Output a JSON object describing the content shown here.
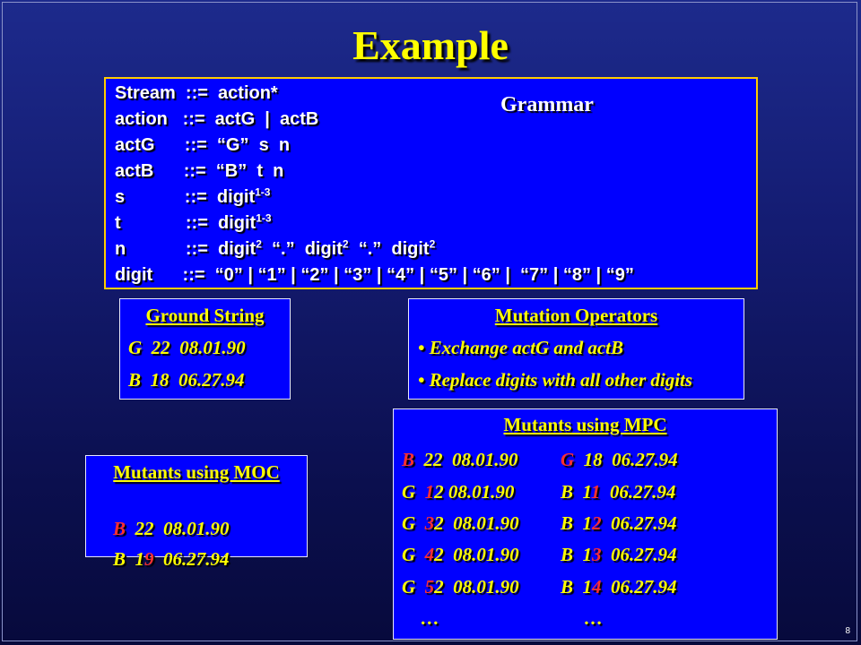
{
  "title": "Example",
  "grammar": {
    "label": "Grammar",
    "lines": [
      {
        "text": "Stream  ::=  action*"
      },
      {
        "text": "action   ::=  actG  |  actB"
      },
      {
        "text": "actG      ::=  “G”  s  n"
      },
      {
        "text": "actB      ::=  “B”  t  n"
      },
      {
        "text": "s            ::=  digit",
        "sup": "1-3"
      },
      {
        "text": "t             ::=  digit",
        "sup": "1-3"
      },
      {
        "text": "n            ::=  digit",
        "sup": "2",
        "t2": "  “.”  digit",
        "sup2": "2",
        "t3": "  “.”  digit",
        "sup3": "2"
      },
      {
        "text": "digit      ::=  “0” | “1” | “2” | “3” | “4” | “5” | “6” |  “7” | “8” | “9”"
      }
    ]
  },
  "ground": {
    "title": "Ground String",
    "lines": [
      "G  22  08.01.90",
      "B  18  06.27.94"
    ]
  },
  "mutation_operators": {
    "title": "Mutation Operators",
    "items": [
      "• Exchange actG and actB",
      "• Replace digits with all other digits"
    ]
  },
  "moc": {
    "title": "Mutants using MOC",
    "rows": [
      [
        {
          "t": "B",
          "r": true
        },
        {
          "t": "  22  08.01.90"
        }
      ],
      [
        {
          "t": "B  1"
        },
        {
          "t": "9",
          "r": true
        },
        {
          "t": "  06.27.94"
        }
      ]
    ]
  },
  "mpc": {
    "title": "Mutants using MPC",
    "left": [
      [
        {
          "t": "B",
          "r": true
        },
        {
          "t": "  22  08.01.90"
        }
      ],
      [
        {
          "t": "G  "
        },
        {
          "t": "1",
          "r": true
        },
        {
          "t": "2 08.01.90"
        }
      ],
      [
        {
          "t": "G  "
        },
        {
          "t": "3",
          "r": true
        },
        {
          "t": "2  08.01.90"
        }
      ],
      [
        {
          "t": "G  "
        },
        {
          "t": "4",
          "r": true
        },
        {
          "t": "2  08.01.90"
        }
      ],
      [
        {
          "t": "G  "
        },
        {
          "t": "5",
          "r": true
        },
        {
          "t": "2  08.01.90"
        }
      ],
      [
        {
          "t": "    …"
        }
      ]
    ],
    "right": [
      [
        {
          "t": "G",
          "r": true
        },
        {
          "t": "  18  06.27.94"
        }
      ],
      [
        {
          "t": "B  1"
        },
        {
          "t": "1",
          "r": true
        },
        {
          "t": "  06.27.94"
        }
      ],
      [
        {
          "t": "B  1"
        },
        {
          "t": "2",
          "r": true
        },
        {
          "t": "  06.27.94"
        }
      ],
      [
        {
          "t": "B  1"
        },
        {
          "t": "3",
          "r": true
        },
        {
          "t": "  06.27.94"
        }
      ],
      [
        {
          "t": "B  1"
        },
        {
          "t": "4",
          "r": true
        },
        {
          "t": "  06.27.94"
        }
      ],
      [
        {
          "t": "     …"
        }
      ]
    ]
  },
  "page_number": "8",
  "colors": {
    "title": "#ffff00",
    "box": "#0000ff",
    "grammar_border": "#ffcc00",
    "mutated_char": "#ff3030"
  }
}
